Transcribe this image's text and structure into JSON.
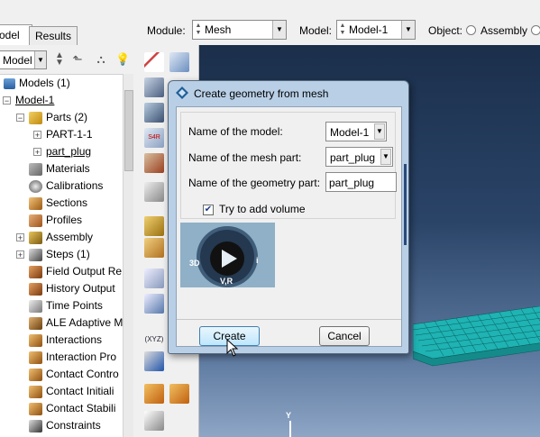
{
  "tabs": {
    "model": "odel",
    "results": "Results"
  },
  "context_bar": {
    "module_label": "Module:",
    "module_value": "Mesh",
    "model_label": "Model:",
    "model_value": "Model-1",
    "object_label": "Object:",
    "assembly_label": "Assembly"
  },
  "tree_toolbar": {
    "combo_value": "Model"
  },
  "tree": {
    "root": "Models (1)",
    "model": "Model-1",
    "parts": "Parts (2)",
    "part1": "PART-1-1",
    "part2": "part_plug",
    "materials": "Materials",
    "calibrations": "Calibrations",
    "sections": "Sections",
    "profiles": "Profiles",
    "assembly": "Assembly",
    "steps": "Steps (1)",
    "field_output": "Field Output Re",
    "history_output": "History Output",
    "time_points": "Time Points",
    "ale": "ALE Adaptive M",
    "interactions": "Interactions",
    "interaction_props": "Interaction Pro",
    "contact_controls": "Contact Contro",
    "contact_init": "Contact Initiali",
    "contact_stab": "Contact Stabili",
    "constraints": "Constraints"
  },
  "dialog": {
    "title": "Create geometry from mesh",
    "model_name_label": "Name of the model:",
    "model_name_value": "Model-1",
    "mesh_part_label": "Name of the mesh part:",
    "mesh_part_value": "part_plug",
    "geom_part_label": "Name of the geometry part:",
    "geom_part_value": "part_plug",
    "volume_label": "Try to add volume",
    "volume_checked": true,
    "create_label": "Create",
    "cancel_label": "Cancel"
  },
  "logo": {
    "left": "3D",
    "right": "i",
    "bottom": "V,R"
  },
  "viewport": {
    "axis_label": "Y"
  },
  "colors": {
    "mesh": "#1fb3b3",
    "mesh_line": "#0b5d5d",
    "viewport_top": "#1b2f4b",
    "dialog_frame": "#b8cfe6"
  }
}
